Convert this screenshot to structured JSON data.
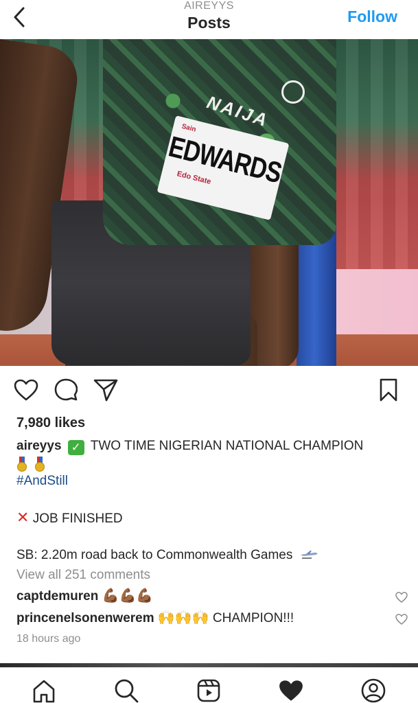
{
  "header": {
    "username": "AIREYYS",
    "title": "Posts",
    "follow_label": "Follow"
  },
  "post_image": {
    "jersey_text": "NAIJA",
    "bib_top": "Sain",
    "bib_name": "EDWARDS",
    "bib_bottom": "Edo State"
  },
  "post": {
    "likes": "7,980 likes",
    "author": "aireyys",
    "caption_line1": "TWO TIME NIGERIAN NATIONAL CHAMPION",
    "hashtag": "#AndStill",
    "line_job": "JOB FINISHED",
    "line_sb": "SB: 2.20m road back to Commonwealth Games",
    "view_all": "View all 251 comments",
    "time": "18 hours ago"
  },
  "comments": [
    {
      "user": "captdemuren",
      "text": "",
      "emoji": "💪🏾💪🏾💪🏾"
    },
    {
      "user": "princenelsonenwerem",
      "text": "CHAMPION!!!",
      "emoji": "🙌🙌🙌"
    }
  ],
  "icons": {
    "back": "chevron-left-icon",
    "like": "heart-outline-icon",
    "comment": "comment-bubble-icon",
    "share": "paper-plane-icon",
    "save": "bookmark-icon",
    "tab_home": "home-icon",
    "tab_search": "search-icon",
    "tab_reels": "reels-icon",
    "tab_activity": "heart-filled-icon",
    "tab_profile": "profile-icon"
  },
  "colors": {
    "follow": "#1e9bf0",
    "hashtag": "#1b4c8a",
    "muted": "#8e8e8e"
  }
}
